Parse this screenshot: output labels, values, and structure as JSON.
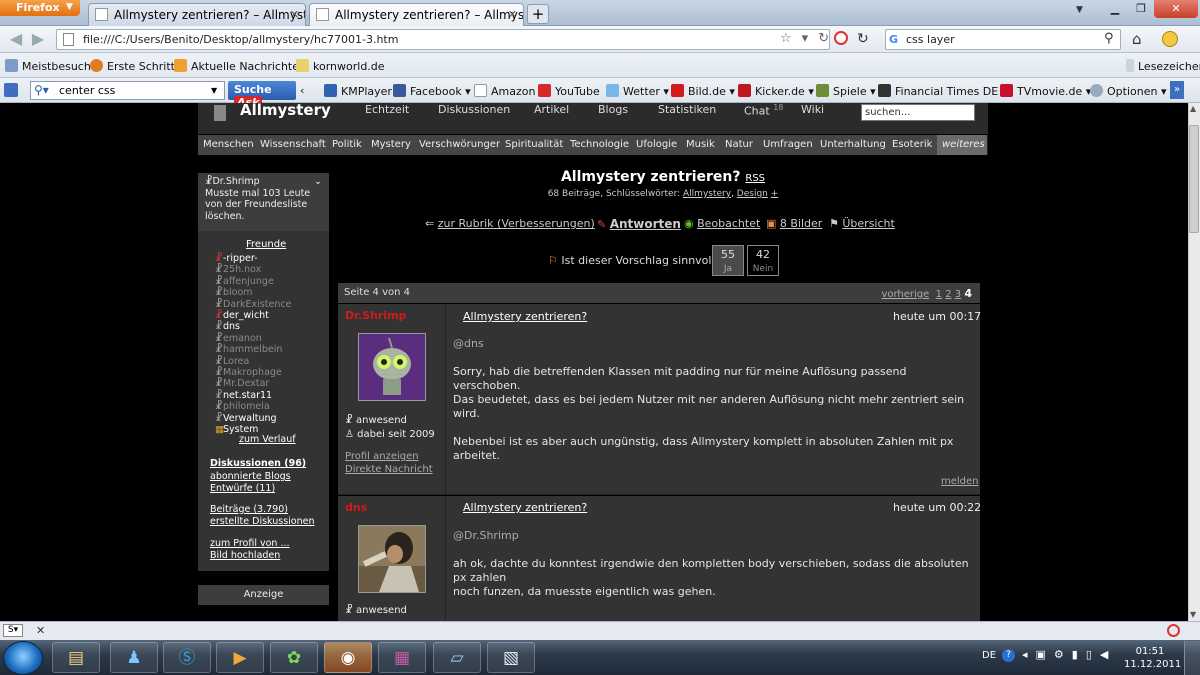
{
  "browser": {
    "menu_button": "Firefox",
    "tabs": [
      {
        "label": "Allmystery zentrieren? – Allmystery"
      },
      {
        "label": "Allmystery zentrieren? – Allmystery"
      }
    ],
    "new_tab": "+",
    "url": "file:///C:/Users/Benito/Desktop/allmystery/hc77001-3.htm",
    "search_value": "css layer",
    "bookmarks": [
      "Meistbesucht",
      "Erste Schritte",
      "Aktuelle Nachrichten",
      "kornworld.de"
    ],
    "bookmarks_right": "Lesezeichen",
    "ask_input": "center css",
    "ask_search": "Suche",
    "ask_brand": "Ask",
    "toolbar_items": [
      "KMPlayer",
      "Facebook",
      "Amazon",
      "YouTube",
      "Wetter",
      "Bild.de",
      "Kicker.de",
      "Spiele",
      "Financial Times DE",
      "TVmovie.de",
      "Optionen"
    ]
  },
  "site": {
    "logo": "Allmystery",
    "topnav": [
      "Echtzeit",
      "Diskussionen",
      "Artikel",
      "Blogs",
      "Statistiken",
      "Chat",
      "Wiki"
    ],
    "chat_count": "18",
    "search_placeholder": "suchen...",
    "categories": [
      "Menschen",
      "Wissenschaft",
      "Politik",
      "Mystery",
      "Verschwörungen",
      "Spiritualität",
      "Technologie",
      "Ufologie",
      "Musik",
      "Natur",
      "Umfragen",
      "Unterhaltung",
      "Esoterik",
      "weiteres"
    ]
  },
  "sidebar": {
    "user": "Dr.Shrimp",
    "note": "Musste mal 103 Leute von der Freundesliste löschen.",
    "friends_title": "Freunde",
    "friends": [
      {
        "name": "-ripper-",
        "online": true
      },
      {
        "name": "25h.nox",
        "online": false
      },
      {
        "name": "affenjunge",
        "online": false
      },
      {
        "name": "bloom",
        "online": false
      },
      {
        "name": "DarkExistence",
        "online": false
      },
      {
        "name": "der_wicht",
        "online": true
      },
      {
        "name": "dns",
        "online": true
      },
      {
        "name": "emanon",
        "online": false
      },
      {
        "name": "hammelbein",
        "online": false
      },
      {
        "name": "Lorea",
        "online": false
      },
      {
        "name": "Makrophage",
        "online": false
      },
      {
        "name": "Mr.Dextar",
        "online": false
      },
      {
        "name": "net.star11",
        "online": true
      },
      {
        "name": "philomela",
        "online": false
      },
      {
        "name": "Verwaltung",
        "online": true
      },
      {
        "name": "System",
        "online": true
      }
    ],
    "history": "zum Verlauf",
    "links1": [
      "Diskussionen (96)",
      "abonnierte Blogs",
      "Entwürfe (11)"
    ],
    "links2": [
      "Beiträge (3.790)",
      "erstellte Diskussionen"
    ],
    "links3": [
      "zum Profil von ...",
      "Bild hochladen"
    ],
    "ad": "Anzeige"
  },
  "thread": {
    "title": "Allmystery zentrieren?",
    "rss": "RSS",
    "subtitle": "68 Beiträge, Schlüsselwörter:",
    "kw1": "Allmystery",
    "kw2": "Design",
    "kw_plus": "+",
    "back": "zur Rubrik (Verbesserungen)",
    "reply": "Antworten",
    "watch": "Beobachtet",
    "images": "8 Bilder",
    "overview": "Übersicht",
    "vote_q": "Ist dieser Vorschlag sinnvoll?",
    "yes_count": "55",
    "yes": "Ja",
    "no_count": "42",
    "no": "Nein",
    "page_info": "Seite 4 von 4",
    "prev": "vorherige",
    "pages": [
      "1",
      "2",
      "3",
      "4"
    ]
  },
  "posts": [
    {
      "user": "Dr.Shrimp",
      "title": "Allmystery zentrieren?",
      "time": "heute um 00:17",
      "mention": "@dns",
      "p1": "Sorry, hab die betreffenden Klassen mit padding nur für meine Auflösung passend verschoben.",
      "p2": "Das beudetet, dass es bei jedem Nutzer mit ner anderen Auflösung nicht mehr zentriert sein wird.",
      "p3": "Nebenbei ist es aber auch ungünstig, dass Allmystery komplett in absoluten Zahlen mit px arbeitet.",
      "status": "anwesend",
      "since": "dabei seit 2009",
      "profile": "Profil anzeigen",
      "message": "Direkte Nachricht",
      "report": "melden"
    },
    {
      "user": "dns",
      "title": "Allmystery zentrieren?",
      "time": "heute um 00:22",
      "mention": "@Dr.Shrimp",
      "p1": "ah ok, dachte du konntest irgendwie den kompletten body verschieben, sodass die absoluten px zahlen",
      "p2": "noch funzen, da muesste eigentlich was gehen.",
      "status": "anwesend"
    }
  ],
  "taskbar": {
    "lang": "DE",
    "time": "01:51",
    "date": "11.12.2011"
  }
}
